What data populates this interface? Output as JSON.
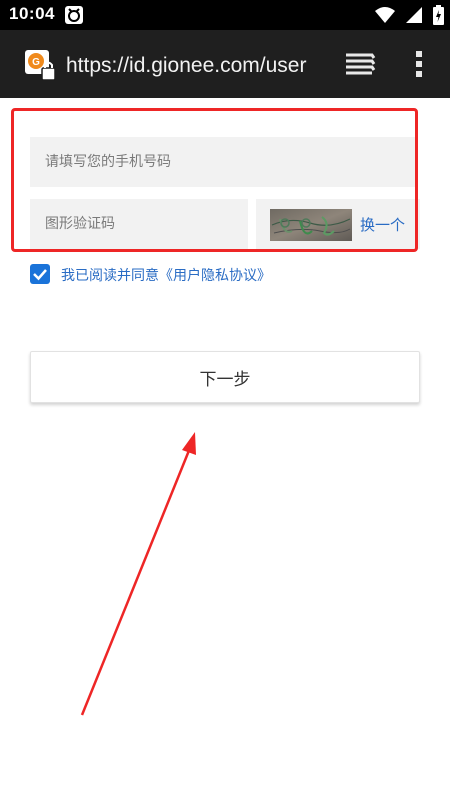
{
  "status_bar": {
    "time": "10:04"
  },
  "browser": {
    "url": "https://id.gionee.com/user",
    "tabs_icon": "tabs-stack-icon",
    "menu_icon": "overflow-menu-icon"
  },
  "form": {
    "phone_placeholder": "请填写您的手机号码",
    "captcha_placeholder": "图形验证码",
    "refresh_label": "换一个",
    "agree_label": "我已阅读并同意《用户隐私协议》",
    "agree_checked": true,
    "next_label": "下一步"
  },
  "colors": {
    "accent": "#2a6cc4",
    "checkbox": "#1a73d9",
    "annotation": "#ee2626"
  }
}
